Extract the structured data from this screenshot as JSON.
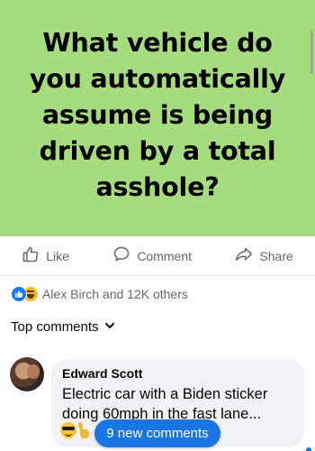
{
  "post": {
    "image_text": "What vehicle do you automatically assume is being driven by a total asshole?",
    "background_color": "#a5dc7d"
  },
  "actions": {
    "like_label": "Like",
    "comment_label": "Comment",
    "share_label": "Share"
  },
  "reactions": {
    "summary": "Alex Birch and 12K others",
    "icons": [
      "like-icon",
      "haha-icon"
    ]
  },
  "comments_filter": {
    "label": "Top comments"
  },
  "comment": {
    "author": "Edward Scott",
    "text": "Electric car with a Biden sticker doing 60mph in the fast lane...",
    "emojis": [
      "sunglasses-face-emoji",
      "victory-hand-emoji"
    ]
  },
  "new_comments_button": {
    "label": "9 new comments"
  },
  "colors": {
    "accent": "#1b74e4",
    "secondary_text": "#65676b"
  }
}
